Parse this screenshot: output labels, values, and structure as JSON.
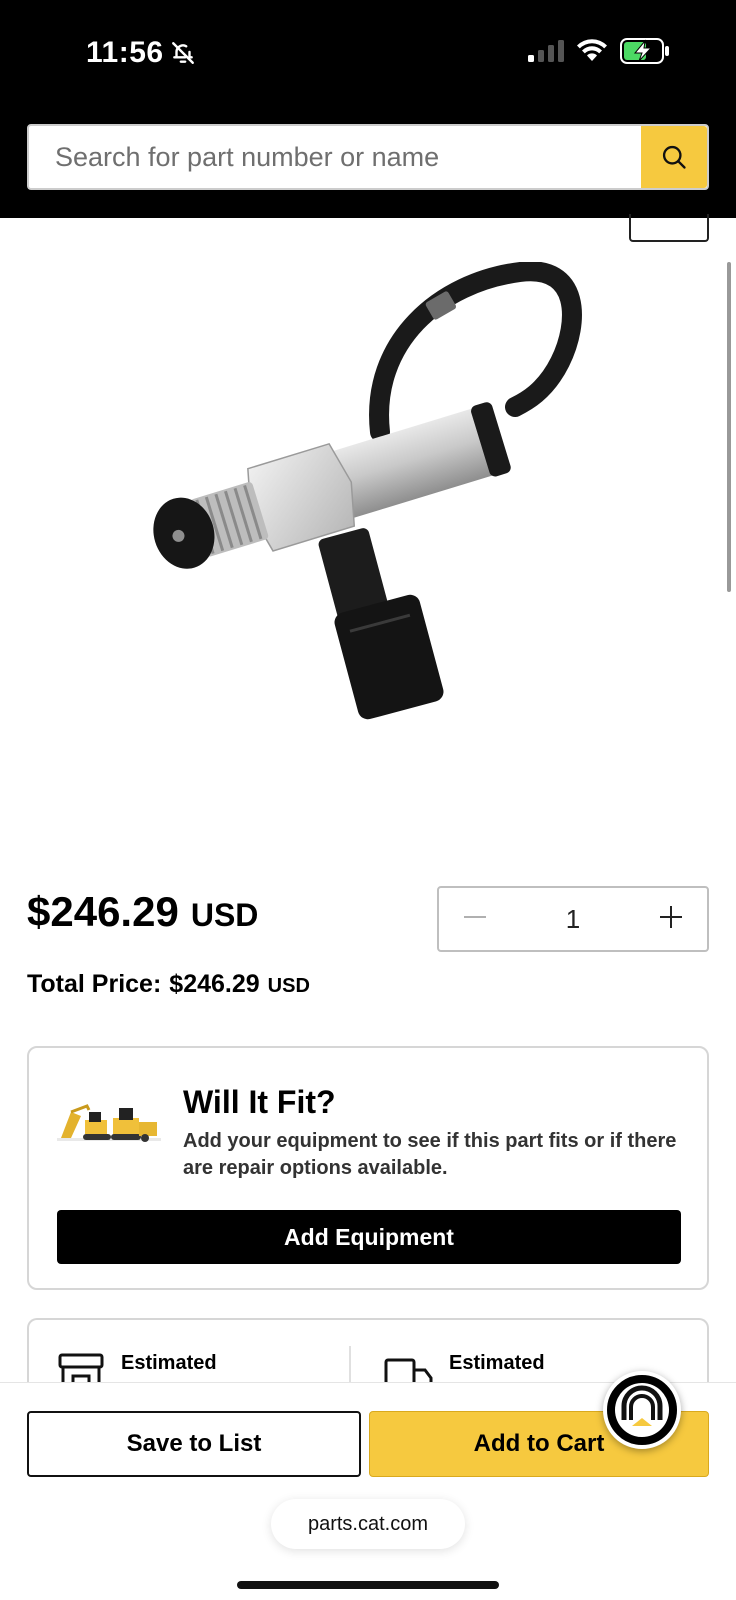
{
  "status_bar": {
    "time": "11:56",
    "icons": [
      "bell-slash-icon",
      "cellular-signal-icon",
      "wifi-icon",
      "battery-charging-icon"
    ]
  },
  "search": {
    "placeholder": "Search for part number or name",
    "button_icon": "search-icon"
  },
  "product": {
    "image": "pressure-sensor-with-wiring-harness",
    "price": "$246.29",
    "price_currency": "USD",
    "quantity": "1",
    "total_label": "Total Price:",
    "total_value": "$246.29",
    "total_currency": "USD"
  },
  "fit_card": {
    "title": "Will It Fit?",
    "description": "Add your equipment to see if this part fits or if there are repair options available.",
    "button_label": "Add Equipment",
    "image": "equipment-illustration"
  },
  "estimated": {
    "items": [
      {
        "label": "Estimated",
        "icon": "store-icon"
      },
      {
        "label": "Estimated",
        "icon": "delivery-truck-icon"
      }
    ]
  },
  "actions": {
    "save_label": "Save to List",
    "cart_label": "Add to Cart",
    "chat_icon": "cat-chat-logo-icon"
  },
  "browser": {
    "url": "parts.cat.com"
  },
  "colors": {
    "accent": "#f6c93f",
    "header_bg": "#000000",
    "button_dark": "#000000"
  }
}
